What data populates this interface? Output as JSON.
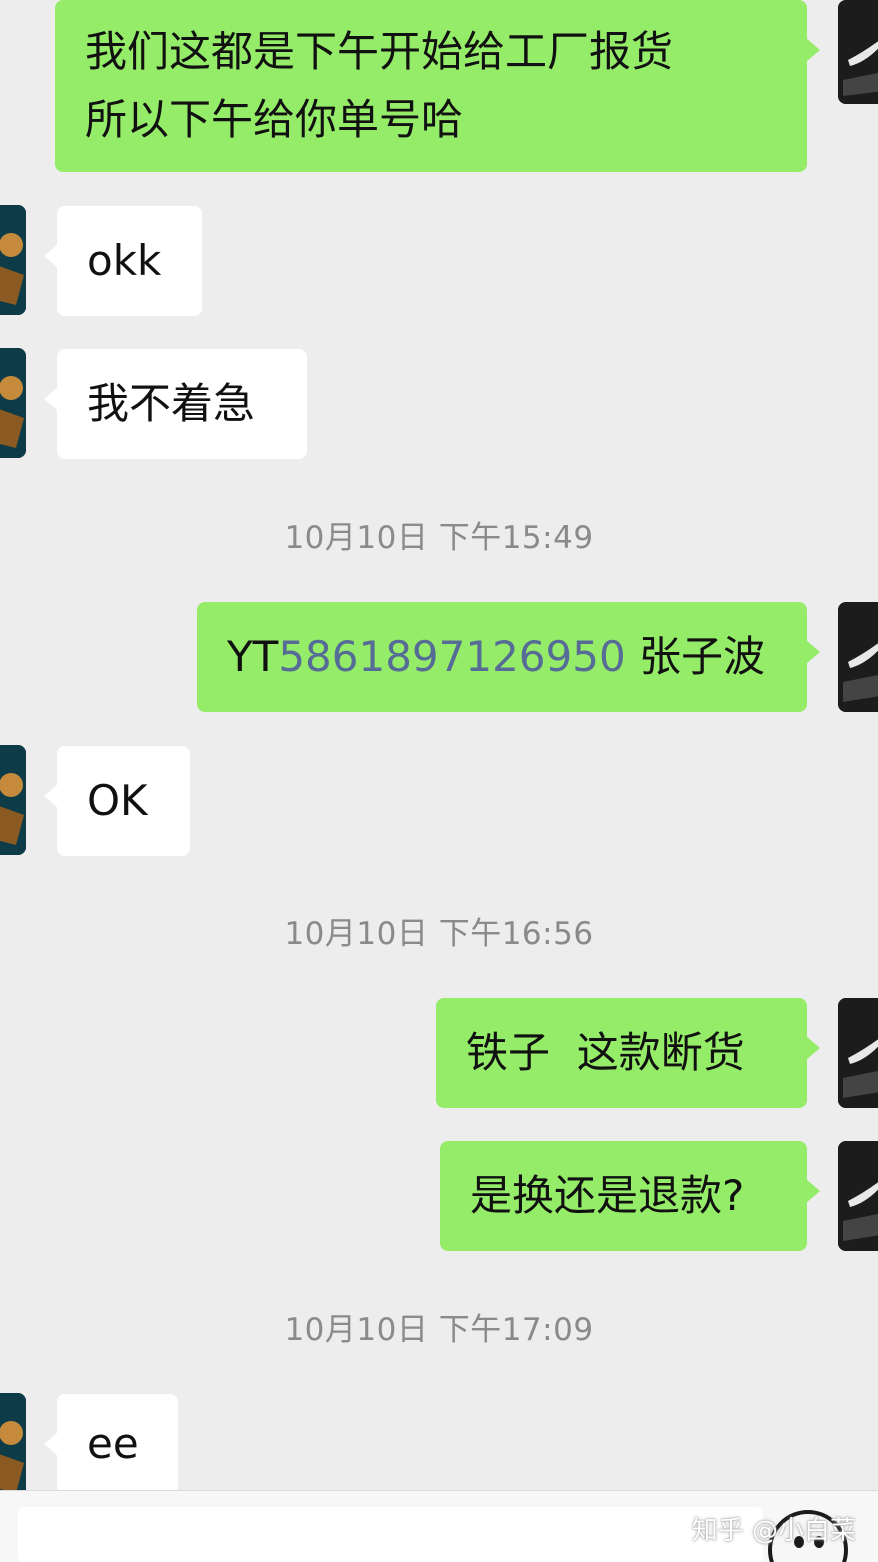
{
  "messages": [
    {
      "side": "mine",
      "lines": [
        "我们这都是下午开始给工厂报货",
        "所以下午给你单号哈"
      ]
    },
    {
      "side": "theirs",
      "text": "okk"
    },
    {
      "side": "theirs",
      "text": "我不着急"
    },
    {
      "timestamp": "10月10日 下午15:49"
    },
    {
      "side": "mine",
      "prefix": "YT",
      "tracking_number": "5861897126950",
      "suffix": " 张子波"
    },
    {
      "side": "theirs",
      "text": "OK"
    },
    {
      "timestamp": "10月10日 下午16:56"
    },
    {
      "side": "mine",
      "text": "铁子  这款断货"
    },
    {
      "side": "mine",
      "text": "是换还是退款?"
    },
    {
      "timestamp": "10月10日 下午17:09"
    },
    {
      "side": "theirs",
      "text": "ee"
    }
  ],
  "watermark": "知乎 @小白菜",
  "colors": {
    "background": "#ededed",
    "my_bubble": "#95ec69",
    "their_bubble": "#ffffff",
    "timestamp_text": "#8a8a8a",
    "link_number": "#566b95"
  },
  "icons": {
    "my_avatar": "sneaker-swoosh-avatar",
    "their_avatar": "figure-avatar",
    "emoji_button": "smiley-icon"
  }
}
